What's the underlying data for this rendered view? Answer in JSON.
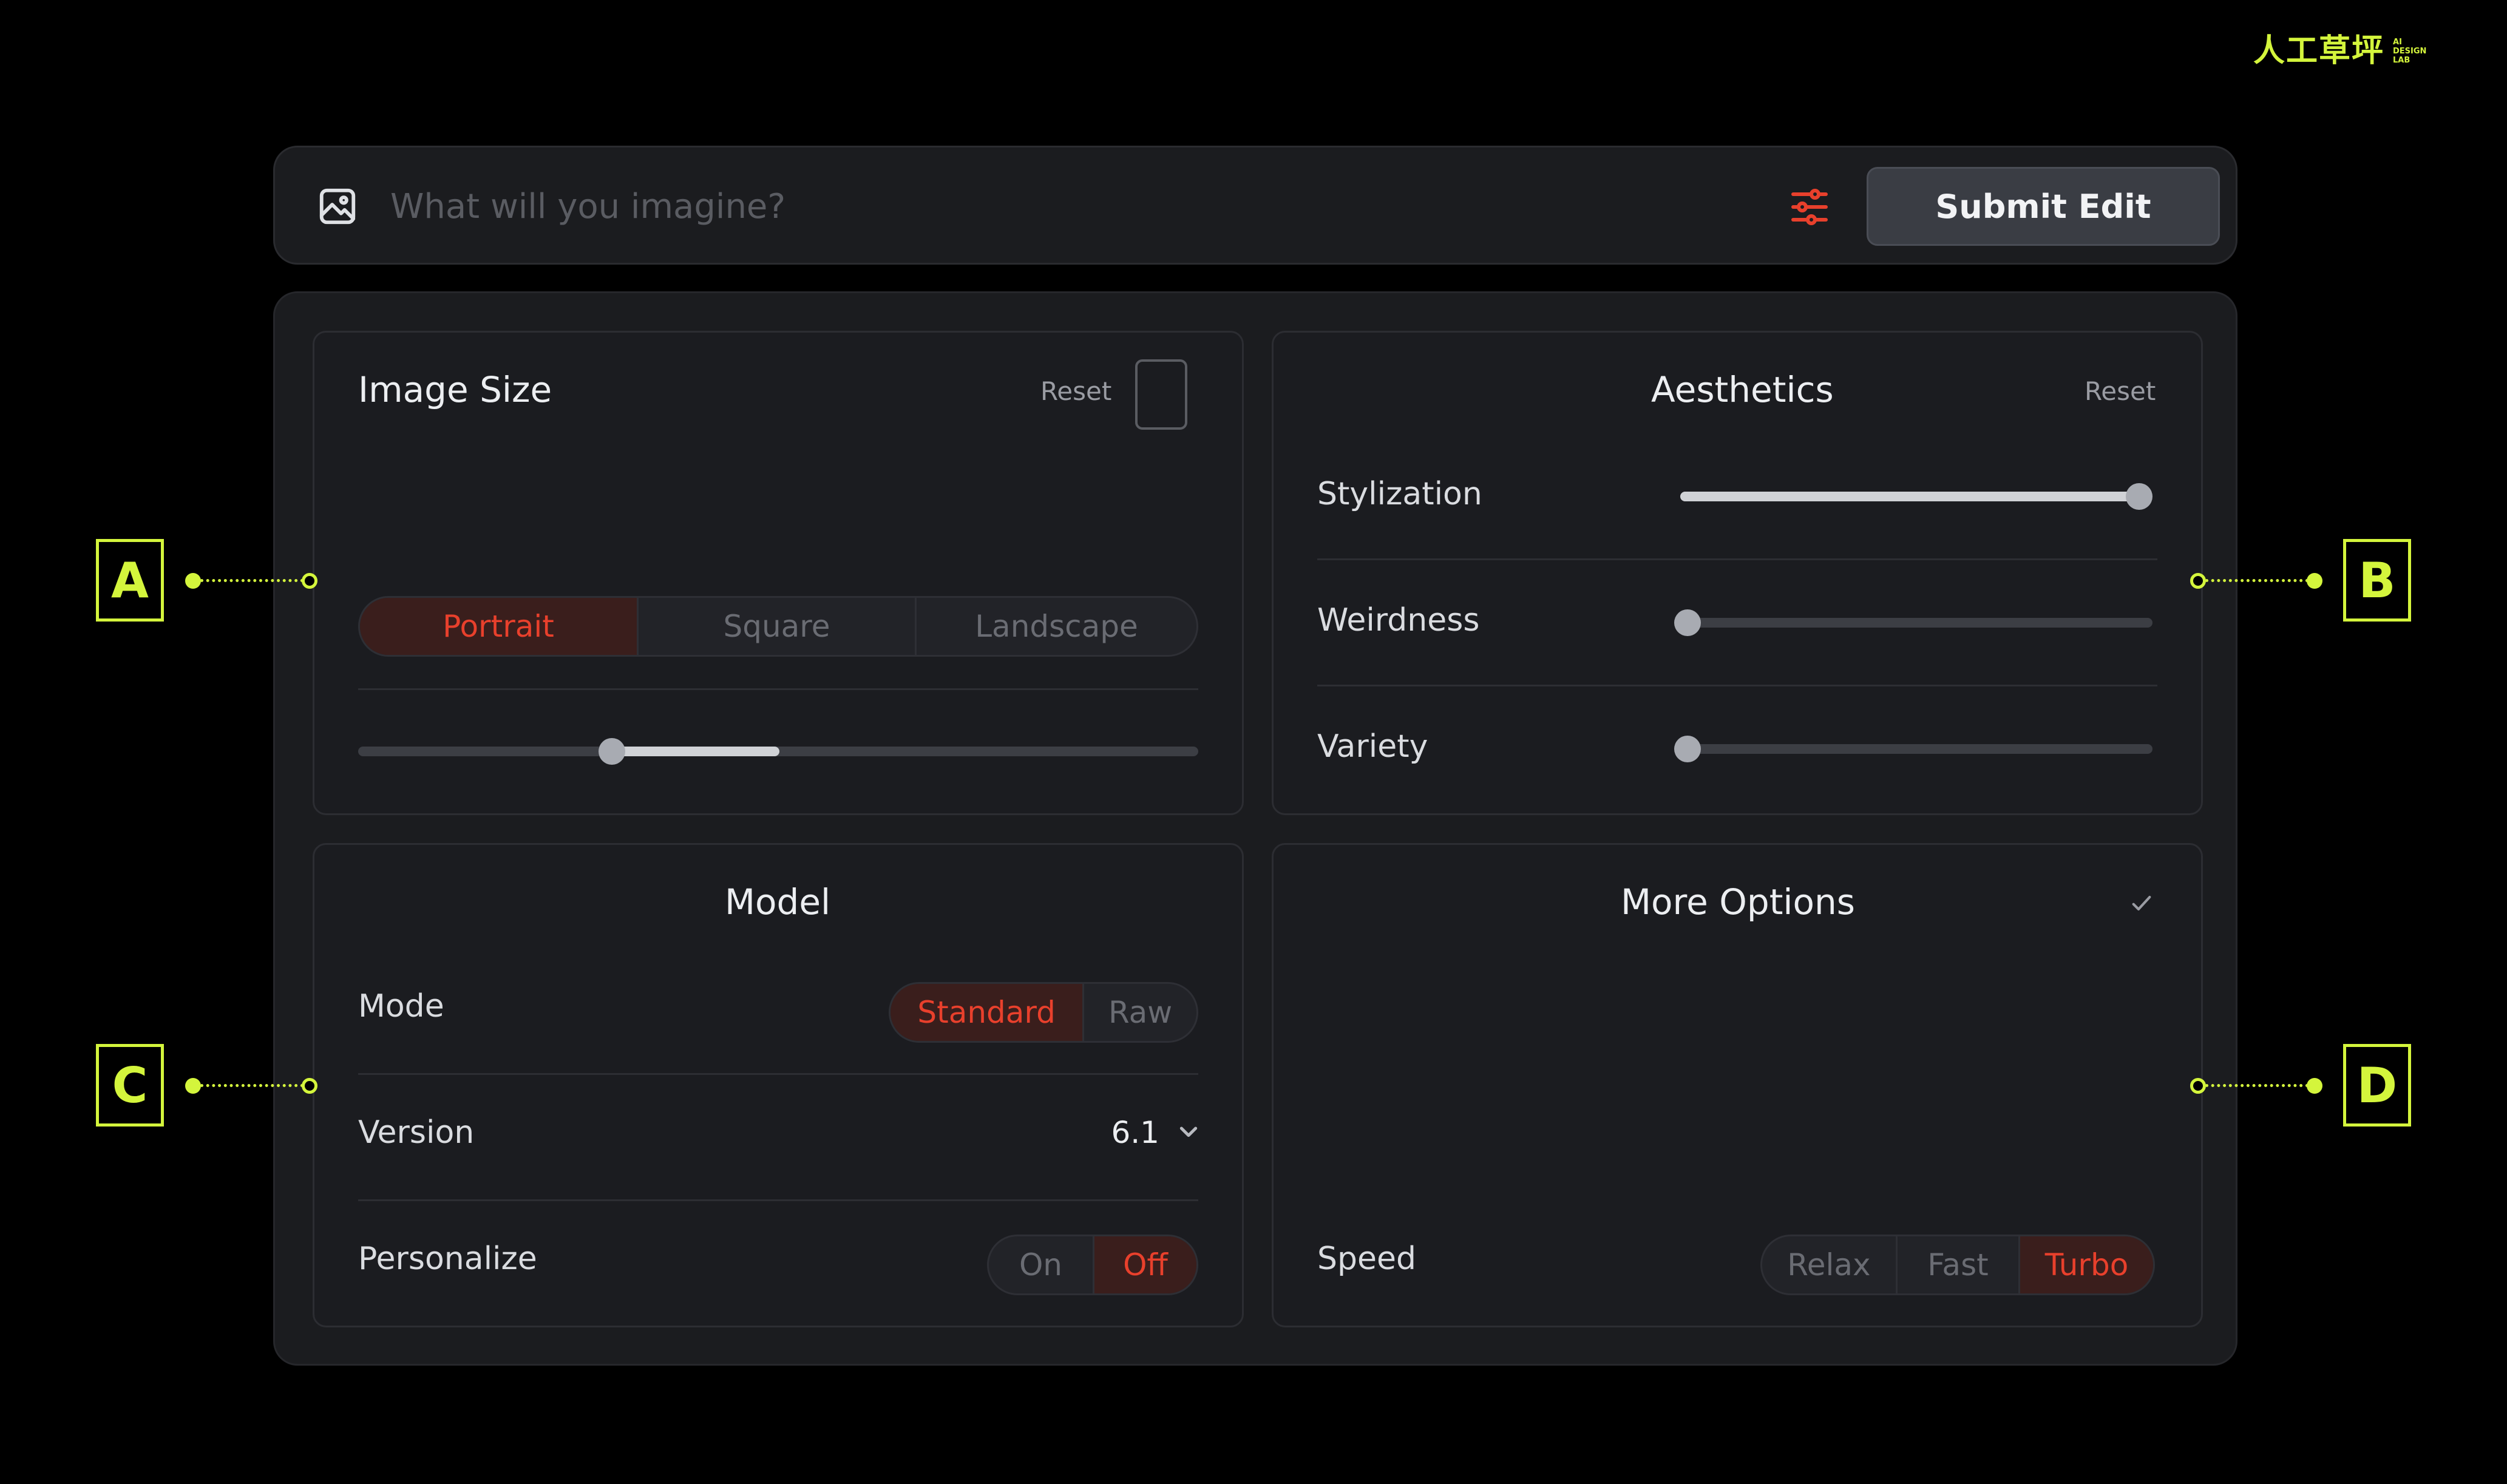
{
  "brand": {
    "cn": "人工草坪",
    "en_lines": [
      "AI",
      "DESIGN",
      "LAB"
    ]
  },
  "prompt": {
    "placeholder": "What will you imagine?",
    "image_icon": "image-icon",
    "settings_icon": "sliders-icon",
    "submit_label": "Submit Edit"
  },
  "image_size": {
    "title": "Image Size",
    "reset": "Reset",
    "orientations": [
      "Portrait",
      "Square",
      "Landscape"
    ],
    "selected": "Portrait",
    "ratio_slider": {
      "value": 0.3,
      "fill_end": 0.5
    }
  },
  "aesthetics": {
    "title": "Aesthetics",
    "reset": "Reset",
    "sliders": [
      {
        "label": "Stylization",
        "value": 1.0
      },
      {
        "label": "Weirdness",
        "value": 0.0
      },
      {
        "label": "Variety",
        "value": 0.0
      }
    ]
  },
  "model": {
    "title": "Model",
    "mode_label": "Mode",
    "modes": [
      "Standard",
      "Raw"
    ],
    "mode_selected": "Standard",
    "version_label": "Version",
    "version_value": "6.1",
    "personalize_label": "Personalize",
    "personalize_options": [
      "On",
      "Off"
    ],
    "personalize_selected": "Off"
  },
  "more_options": {
    "title": "More Options",
    "collapse_icon": "check-icon",
    "speed_label": "Speed",
    "speeds": [
      "Relax",
      "Fast",
      "Turbo"
    ],
    "speed_selected": "Turbo"
  },
  "callouts": [
    "A",
    "B",
    "C",
    "D"
  ],
  "colors": {
    "accent": "#e8402c",
    "callout": "#d4f53c",
    "background": "#000000",
    "panel": "#1b1c1f"
  }
}
